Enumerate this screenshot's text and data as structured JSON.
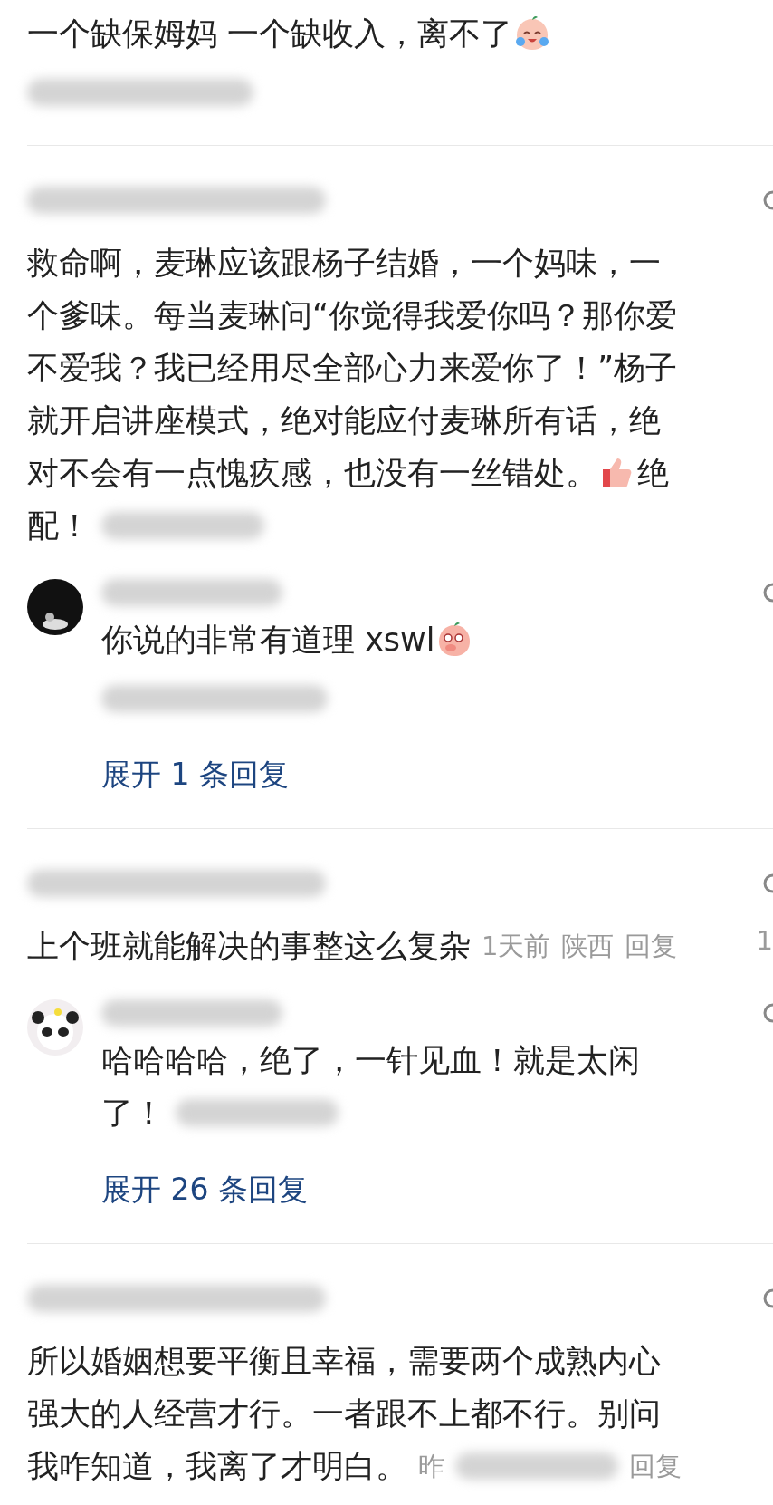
{
  "comments": [
    {
      "lines": [
        [
          {
            "kind": "text",
            "text": "一个缺保姆妈 一个缺收入，离不了"
          },
          {
            "kind": "crying-emoji"
          }
        ]
      ],
      "meta_line": [
        {
          "kind": "blurred"
        }
      ]
    },
    {
      "author": {
        "kind": "blurred"
      },
      "lines": [
        [
          {
            "kind": "text",
            "text": "救命啊，麦琳应该跟杨子结婚，一个妈味，一"
          }
        ],
        [
          {
            "kind": "text",
            "text": "个爹味。每当麦琳问“你觉得我爱你吗？那你爱"
          }
        ],
        [
          {
            "kind": "text",
            "text": "不爱我？我已经用尽全部心力来爱你了！”杨子"
          }
        ],
        [
          {
            "kind": "text",
            "text": "就开启讲座模式，绝对能应付麦琳所有话，绝"
          }
        ],
        [
          {
            "kind": "text",
            "text": "对不会有一点愧疚感，也没有一丝错处。"
          },
          {
            "kind": "thumbs-emoji"
          },
          {
            "kind": "text",
            "text": "绝"
          }
        ],
        [
          {
            "kind": "text",
            "text": "配！"
          },
          {
            "kind": "blurred"
          }
        ]
      ],
      "replies": [
        {
          "kind": "dark-avatar",
          "lines": [
            [
              {
                "kind": "text",
                "text": "你说的非常有道理 xswl"
              },
              {
                "kind": "giggle-emoji"
              }
            ]
          ],
          "meta_line": [
            {
              "kind": "blurred"
            }
          ]
        }
      ],
      "expand": "展开 1 条回复"
    },
    {
      "author": {
        "kind": "blurred"
      },
      "lines": [
        [
          {
            "kind": "text",
            "text": "上个班就能解决的事整这么复杂"
          },
          {
            "kind": "meta",
            "text": "1天前"
          },
          {
            "kind": "meta",
            "text": "陕西"
          },
          {
            "kind": "reply",
            "text": "回复"
          }
        ]
      ],
      "likes": "1",
      "replies": [
        {
          "kind": "panda-avatar",
          "lines": [
            [
              {
                "kind": "text",
                "text": "哈哈哈哈，绝了，一针见血！就是太闲"
              }
            ],
            [
              {
                "kind": "text",
                "text": "了！"
              },
              {
                "kind": "blurred"
              }
            ]
          ]
        }
      ],
      "expand": "展开 26 条回复"
    },
    {
      "author": {
        "kind": "blurred"
      },
      "lines": [
        [
          {
            "kind": "text",
            "text": "所以婚姻想要平衡且幸福，需要两个成熟内心"
          }
        ],
        [
          {
            "kind": "text",
            "text": "强大的人经营才行。一者跟不上都不行。别问"
          }
        ],
        [
          {
            "kind": "text",
            "text": "我咋知道，我离了才明白。"
          },
          {
            "kind": "meta",
            "text": "昨"
          },
          {
            "kind": "blurred"
          },
          {
            "kind": "reply",
            "text": "回复"
          }
        ]
      ]
    }
  ]
}
